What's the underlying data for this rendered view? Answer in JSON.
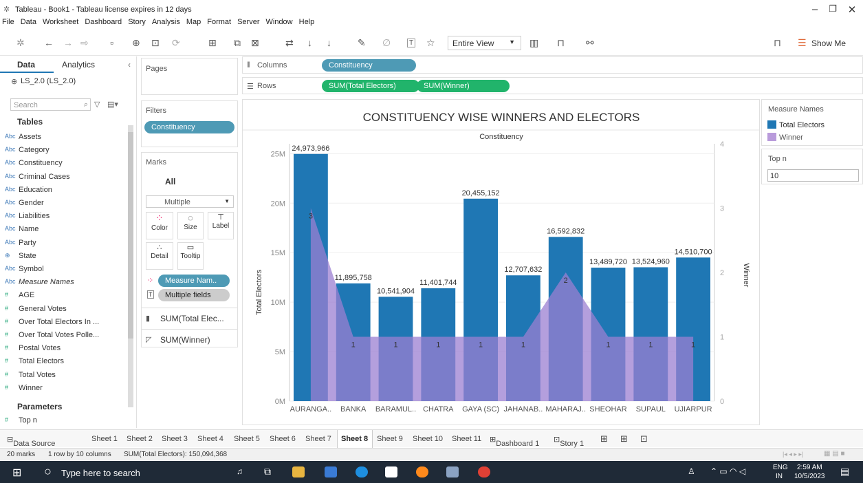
{
  "window": {
    "title": "Tableau - Book1 - Tableau license expires in 12 days"
  },
  "menu": [
    "File",
    "Data",
    "Worksheet",
    "Dashboard",
    "Story",
    "Analysis",
    "Map",
    "Format",
    "Server",
    "Window",
    "Help"
  ],
  "toolbar": {
    "view_select": "Entire View",
    "show_me": "Show Me"
  },
  "data_pane": {
    "tabs": [
      "Data",
      "Analytics"
    ],
    "datasource": "LS_2.0 (LS_2.0)",
    "search_placeholder": "Search",
    "tables_header": "Tables",
    "dimensions": [
      {
        "type": "Abc",
        "name": "Assets"
      },
      {
        "type": "Abc",
        "name": "Category"
      },
      {
        "type": "Abc",
        "name": "Constituency"
      },
      {
        "type": "Abc",
        "name": "Criminal Cases"
      },
      {
        "type": "Abc",
        "name": "Education"
      },
      {
        "type": "Abc",
        "name": "Gender"
      },
      {
        "type": "Abc",
        "name": "Liabilities"
      },
      {
        "type": "Abc",
        "name": "Name"
      },
      {
        "type": "Abc",
        "name": "Party"
      },
      {
        "type": "⊕",
        "name": "State"
      },
      {
        "type": "Abc",
        "name": "Symbol"
      },
      {
        "type": "Abc",
        "name": "Measure Names"
      }
    ],
    "measures": [
      {
        "type": "#",
        "name": "AGE"
      },
      {
        "type": "#",
        "name": "General Votes"
      },
      {
        "type": "#",
        "name": "Over Total Electors In ..."
      },
      {
        "type": "#",
        "name": "Over Total Votes Polle..."
      },
      {
        "type": "#",
        "name": "Postal Votes"
      },
      {
        "type": "#",
        "name": "Total Electors"
      },
      {
        "type": "#",
        "name": "Total Votes"
      },
      {
        "type": "#",
        "name": "Winner"
      }
    ],
    "parameters_header": "Parameters",
    "parameters": [
      {
        "type": "#",
        "name": "Top n"
      }
    ]
  },
  "shelves": {
    "pages": "Pages",
    "filters": "Filters",
    "filter_pill": "Constituency",
    "marks": "Marks",
    "marks_all": "All",
    "mark_type": "Multiple",
    "mark_buttons": [
      "Color",
      "Size",
      "Label",
      "Detail",
      "Tooltip"
    ],
    "mark_pills": [
      "Measure Nam..",
      "Multiple fields"
    ],
    "measure_cards": [
      "SUM(Total Elec...",
      "SUM(Winner)"
    ],
    "columns_label": "Columns",
    "columns_pill": "Constituency",
    "rows_label": "Rows",
    "rows_pills": [
      "SUM(Total Electors)",
      "SUM(Winner)"
    ]
  },
  "chart_data": {
    "type": "bar",
    "title": "CONSTITUENCY WISE WINNERS AND ELECTORS",
    "header": "Constituency",
    "ylabel": "Total Electors",
    "y2label": "Winner",
    "categories": [
      "AURANGA..",
      "BANKA",
      "BARAMUL..",
      "CHATRA",
      "GAYA (SC)",
      "JAHANAB..",
      "MAHARAJ..",
      "SHEOHAR",
      "SUPAUL",
      "UJIARPUR"
    ],
    "series": [
      {
        "name": "Total Electors",
        "values": [
          24973966,
          11895758,
          10541904,
          11401744,
          20455152,
          12707632,
          16592832,
          13489720,
          13524960,
          14510700
        ],
        "labels": [
          "24,973,966",
          "11,895,758",
          "10,541,904",
          "11,401,744",
          "20,455,152",
          "12,707,632",
          "16,592,832",
          "13,489,720",
          "13,524,960",
          "14,510,700"
        ],
        "color": "#1f77b4"
      },
      {
        "name": "Winner",
        "values": [
          3,
          1,
          1,
          1,
          1,
          1,
          2,
          1,
          1,
          1
        ],
        "color": "#9b7fd1"
      }
    ],
    "ylim": [
      0,
      26000000
    ],
    "y_ticks": [
      "0M",
      "5M",
      "10M",
      "15M",
      "20M",
      "25M"
    ],
    "y2lim": [
      0,
      4
    ],
    "y2_ticks": [
      "0",
      "1",
      "2",
      "3",
      "4"
    ]
  },
  "legend": {
    "title": "Measure Names",
    "items": [
      {
        "name": "Total Electors",
        "color": "#1f77b4"
      },
      {
        "name": "Winner",
        "color": "#b99bdb"
      }
    ],
    "param_title": "Top n",
    "param_value": "10"
  },
  "sheet_tabs": [
    "Data Source",
    "Sheet 1",
    "Sheet 2",
    "Sheet 3",
    "Sheet 4",
    "Sheet 5",
    "Sheet 6",
    "Sheet 7",
    "Sheet 8",
    "Sheet 9",
    "Sheet 10",
    "Sheet 11",
    "Dashboard 1",
    "Story 1"
  ],
  "active_tab": "Sheet 8",
  "status": {
    "marks": "20 marks",
    "layout": "1 row by 10 columns",
    "sum": "SUM(Total Electors): 150,094,368"
  },
  "taskbar": {
    "search_placeholder": "Type here to search",
    "lang": "ENG",
    "region": "IN",
    "time": "2:59 AM",
    "date": "10/5/2023"
  }
}
